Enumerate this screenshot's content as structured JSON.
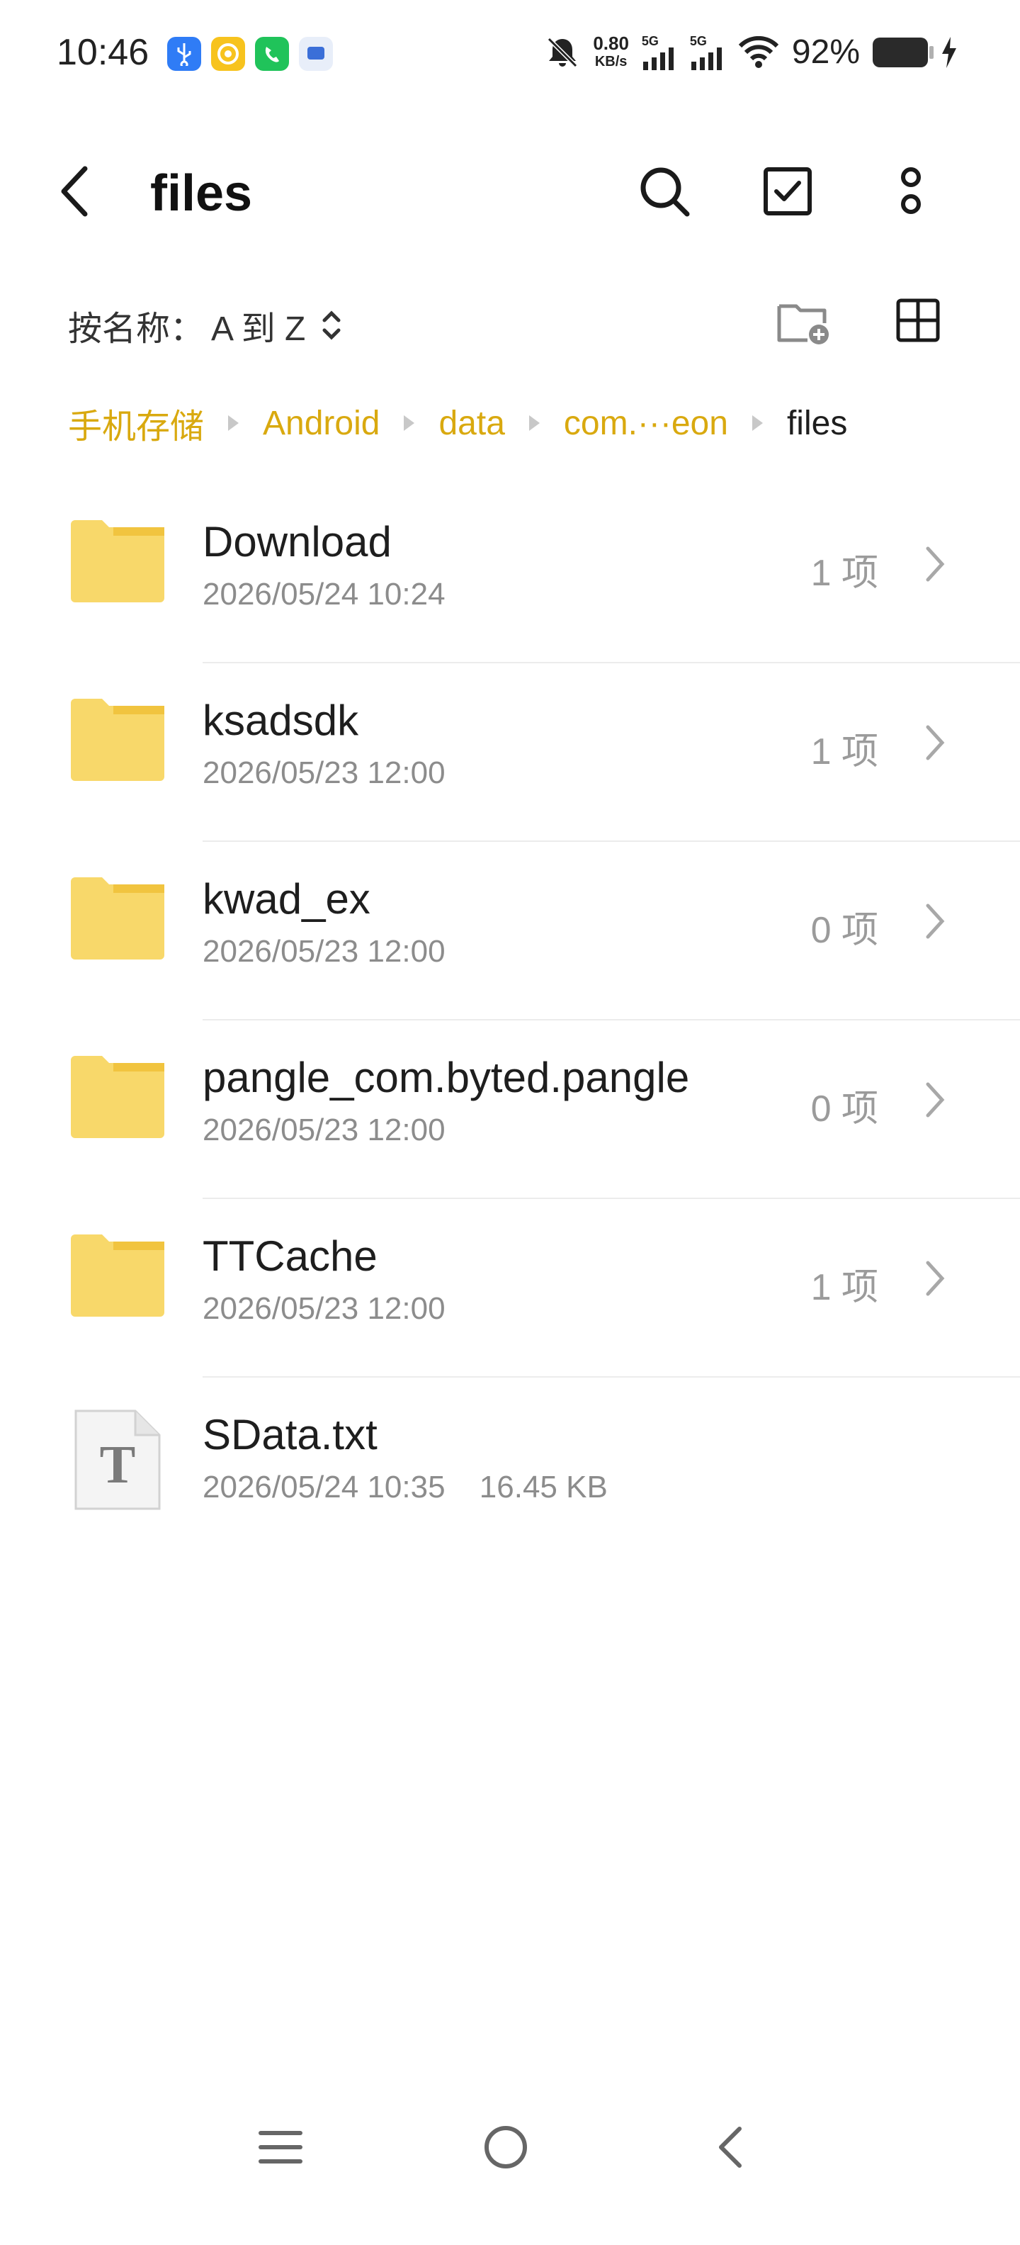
{
  "status_bar": {
    "time": "10:46",
    "net_speed_value": "0.80",
    "net_speed_unit": "KB/s",
    "signal1_label": "5G",
    "signal2_label": "5G",
    "battery_percent": "92%"
  },
  "header": {
    "title": "files"
  },
  "sort": {
    "label": "按名称：",
    "value": "A 到 Z"
  },
  "breadcrumbs": [
    "手机存储",
    "Android",
    "data",
    "com.···eon",
    "files"
  ],
  "items": [
    {
      "name": "Download",
      "date": "2026/05/24 10:24",
      "count": "1 项",
      "type": "folder"
    },
    {
      "name": "ksadsdk",
      "date": "2026/05/23 12:00",
      "count": "1 项",
      "type": "folder"
    },
    {
      "name": "kwad_ex",
      "date": "2026/05/23 12:00",
      "count": "0 项",
      "type": "folder"
    },
    {
      "name": "pangle_com.byted.pangle",
      "date": "2026/05/23 12:00",
      "count": "0 项",
      "type": "folder"
    },
    {
      "name": "TTCache",
      "date": "2026/05/23 12:00",
      "count": "1 项",
      "type": "folder"
    },
    {
      "name": "SData.txt",
      "date": "2026/05/24 10:35",
      "size": "16.45 KB",
      "type": "text-file"
    }
  ],
  "colors": {
    "accent": "#d9a90f",
    "folder": "#f8d86a",
    "folder_tab": "#f1c43f"
  }
}
